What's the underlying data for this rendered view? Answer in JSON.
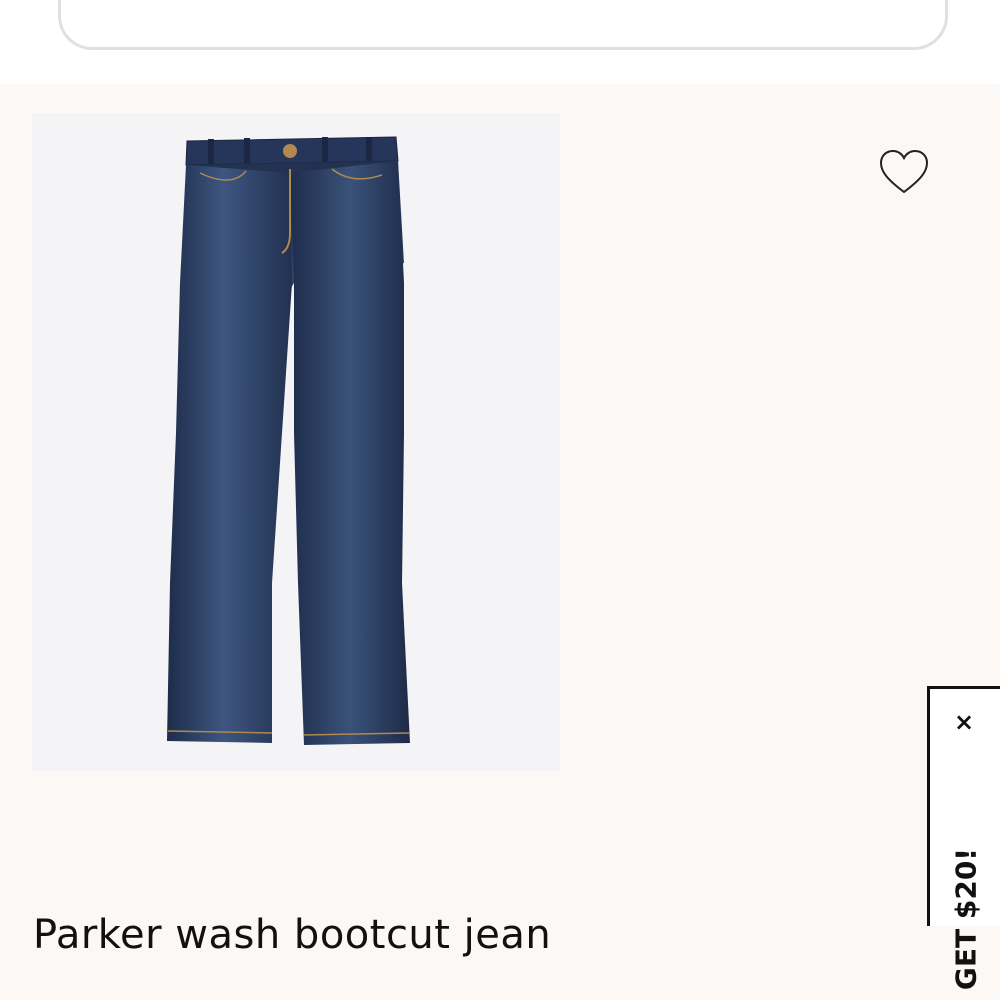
{
  "product": {
    "title": "Parker wash bootcut jean",
    "image_subject": "Parker wash bootcut jean",
    "wishlist_icon": "heart-outline-icon"
  },
  "promo": {
    "label": "GET $20!",
    "close_label": "×"
  },
  "colors": {
    "page_background": "#fbf8f5",
    "header_background": "#ffffff",
    "image_background": "#f4f3f6",
    "denim": "#2a3a5e",
    "text": "#111111"
  }
}
